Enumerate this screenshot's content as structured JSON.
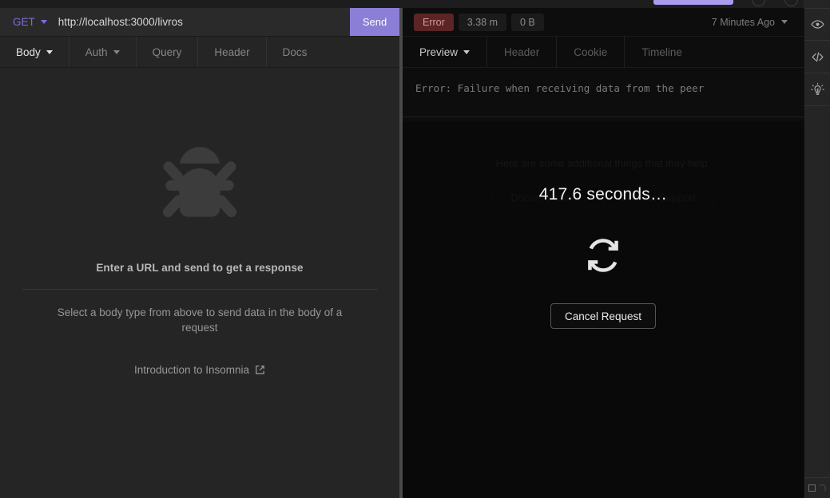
{
  "request": {
    "method": "GET",
    "url": "http://localhost:3000/livros",
    "send_label": "Send",
    "tabs": [
      {
        "label": "Body",
        "active": true,
        "has_caret": true
      },
      {
        "label": "Auth",
        "active": false,
        "has_caret": true
      },
      {
        "label": "Query",
        "active": false,
        "has_caret": false
      },
      {
        "label": "Header",
        "active": false,
        "has_caret": false
      },
      {
        "label": "Docs",
        "active": false,
        "has_caret": false
      }
    ],
    "empty_state": {
      "icon": "bug-icon",
      "title": "Enter a URL and send to get a response",
      "subtitle": "Select a body type from above to send data in the body of a request",
      "link_label": "Introduction to Insomnia",
      "link_icon": "external-link-icon"
    }
  },
  "response": {
    "status_label": "Error",
    "time_label": "3.38 m",
    "size_label": "0 B",
    "timestamp_label": "7 Minutes Ago",
    "tabs": [
      {
        "label": "Preview",
        "active": true,
        "has_caret": true
      },
      {
        "label": "Header",
        "active": false,
        "has_caret": false
      },
      {
        "label": "Cookie",
        "active": false,
        "has_caret": false
      },
      {
        "label": "Timeline",
        "active": false,
        "has_caret": false
      }
    ],
    "error_message": "Error: Failure when receiving data from the peer",
    "help_text": "Here are some additional things that may help.",
    "help_buttons": [
      {
        "label": "Documentation"
      },
      {
        "label": "Contact Support"
      }
    ]
  },
  "loading": {
    "elapsed_label": "417.6 seconds…",
    "spinner_icon": "refresh-spinner-icon",
    "cancel_label": "Cancel Request"
  },
  "rail": {
    "items": [
      {
        "name": "eye-icon"
      },
      {
        "name": "code-icon"
      },
      {
        "name": "lightbulb-icon"
      }
    ]
  },
  "colors": {
    "accent_purple": "#8b7ed6",
    "method_purple": "#7f6cd8",
    "error_bg": "#5c2424",
    "error_text": "#d59a9a",
    "left_panel_bg": "#252525",
    "right_panel_bg": "#0d0d0d"
  }
}
